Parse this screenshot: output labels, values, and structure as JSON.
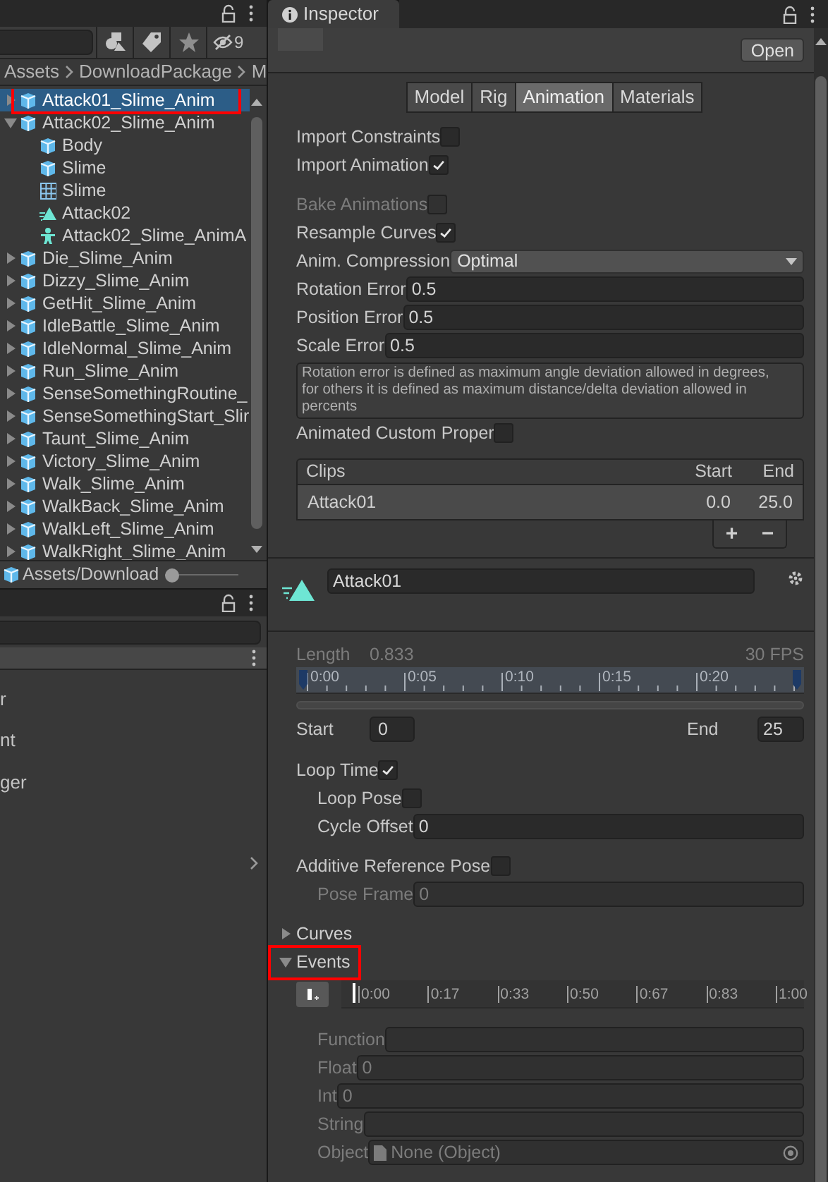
{
  "project": {
    "filter_count": "9",
    "breadcrumb": [
      "Assets",
      "DownloadPackage",
      "M"
    ],
    "tree": [
      {
        "label": "Attack01_Slime_Anim",
        "kind": "model",
        "expanded": false,
        "selected": true,
        "annotated": true
      },
      {
        "label": "Attack02_Slime_Anim",
        "kind": "model",
        "expanded": true,
        "selected": false,
        "annotated": false,
        "children": [
          {
            "label": "Body",
            "kind": "model"
          },
          {
            "label": "Slime",
            "kind": "model"
          },
          {
            "label": "Slime",
            "kind": "mesh"
          },
          {
            "label": "Attack02",
            "kind": "clip"
          },
          {
            "label": "Attack02_Slime_AnimA",
            "kind": "avatar"
          }
        ]
      },
      {
        "label": "Die_Slime_Anim",
        "kind": "model",
        "expanded": false,
        "selected": false,
        "annotated": false
      },
      {
        "label": "Dizzy_Slime_Anim",
        "kind": "model",
        "expanded": false,
        "selected": false,
        "annotated": false
      },
      {
        "label": "GetHit_Slime_Anim",
        "kind": "model",
        "expanded": false,
        "selected": false,
        "annotated": false
      },
      {
        "label": "IdleBattle_Slime_Anim",
        "kind": "model",
        "expanded": false,
        "selected": false,
        "annotated": false
      },
      {
        "label": "IdleNormal_Slime_Anim",
        "kind": "model",
        "expanded": false,
        "selected": false,
        "annotated": false
      },
      {
        "label": "Run_Slime_Anim",
        "kind": "model",
        "expanded": false,
        "selected": false,
        "annotated": false
      },
      {
        "label": "SenseSomethingRoutine_",
        "kind": "model",
        "expanded": false,
        "selected": false,
        "annotated": false
      },
      {
        "label": "SenseSomethingStart_Slir",
        "kind": "model",
        "expanded": false,
        "selected": false,
        "annotated": false
      },
      {
        "label": "Taunt_Slime_Anim",
        "kind": "model",
        "expanded": false,
        "selected": false,
        "annotated": false
      },
      {
        "label": "Victory_Slime_Anim",
        "kind": "model",
        "expanded": false,
        "selected": false,
        "annotated": false
      },
      {
        "label": "Walk_Slime_Anim",
        "kind": "model",
        "expanded": false,
        "selected": false,
        "annotated": false
      },
      {
        "label": "WalkBack_Slime_Anim",
        "kind": "model",
        "expanded": false,
        "selected": false,
        "annotated": false
      },
      {
        "label": "WalkLeft_Slime_Anim",
        "kind": "model",
        "expanded": false,
        "selected": false,
        "annotated": false
      },
      {
        "label": "WalkRight_Slime_Anim",
        "kind": "model",
        "expanded": false,
        "selected": false,
        "annotated": false
      }
    ],
    "footer_path": "Assets/Download",
    "zoom_slider": {
      "level": 0
    }
  },
  "lower_panel": {
    "items": [
      "r",
      "nt",
      "ger"
    ]
  },
  "inspector": {
    "title": "Inspector",
    "open_button": "Open",
    "tabs": [
      {
        "label": "Model",
        "selected": false
      },
      {
        "label": "Rig",
        "selected": false
      },
      {
        "label": "Animation",
        "selected": true
      },
      {
        "label": "Materials",
        "selected": false
      }
    ],
    "row_groups": [
      [
        {
          "kind": "checkbox",
          "label": "Import Constraints",
          "checked": false,
          "disabled": false
        },
        {
          "kind": "checkbox",
          "label": "Import Animation",
          "checked": true,
          "disabled": false
        }
      ],
      [
        {
          "kind": "checkbox",
          "label": "Bake Animations",
          "checked": false,
          "disabled": true
        },
        {
          "kind": "checkbox",
          "label": "Resample Curves",
          "checked": true,
          "disabled": false
        },
        {
          "kind": "dropdown",
          "label": "Anim. Compression",
          "value": "Optimal",
          "disabled": false
        },
        {
          "kind": "field",
          "label": "Rotation Error",
          "value": "0.5",
          "disabled": false
        },
        {
          "kind": "field",
          "label": "Position Error",
          "value": "0.5",
          "disabled": false
        },
        {
          "kind": "field",
          "label": "Scale Error",
          "value": "0.5",
          "disabled": false
        },
        {
          "kind": "help",
          "text": "Rotation error is defined as maximum angle deviation allowed in degrees, for others it is defined as maximum distance/delta deviation allowed in percents"
        },
        {
          "kind": "checkbox",
          "label": "Animated Custom Proper",
          "checked": false,
          "disabled": false
        }
      ]
    ],
    "clips": {
      "columns": [
        "Clips",
        "Start",
        "End"
      ],
      "rows": [
        {
          "name": "Attack01",
          "start": "0.0",
          "end": "25.0",
          "selected": true
        }
      ],
      "add_button": "+",
      "remove_button": "−"
    },
    "clip": {
      "name": "Attack01",
      "length_label": "Length",
      "length": "0.833",
      "fps": "30 FPS",
      "ticks": [
        "0:00",
        "0:05",
        "0:10",
        "0:15",
        "0:20"
      ],
      "start_label": "Start",
      "start": "0",
      "end_label": "End",
      "end": "25",
      "row_groups": [
        [
          {
            "kind": "checkbox",
            "label": "Loop Time",
            "checked": true,
            "disabled": false,
            "children": [
              {
                "kind": "checkbox",
                "label": "Loop Pose",
                "checked": false,
                "disabled": false
              },
              {
                "kind": "field",
                "label": "Cycle Offset",
                "value": "0",
                "disabled": false
              }
            ]
          }
        ],
        [
          {
            "kind": "checkbox",
            "label": "Additive Reference Pose",
            "checked": false,
            "disabled": false,
            "children": [
              {
                "kind": "field",
                "label": "Pose Frame",
                "value": "0",
                "disabled": true
              }
            ]
          }
        ]
      ]
    },
    "foldouts": [
      {
        "label": "Curves",
        "expanded": false,
        "annotated": false
      },
      {
        "label": "Events",
        "expanded": true,
        "annotated": true
      }
    ],
    "events": {
      "ticks": [
        "0:00",
        "0:17",
        "0:33",
        "0:50",
        "0:67",
        "0:83",
        "1:00"
      ],
      "fields": [
        {
          "kind": "field",
          "label": "Function",
          "disabled": true
        },
        {
          "kind": "field",
          "label": "Float",
          "value": "0",
          "disabled": true
        },
        {
          "kind": "field",
          "label": "Int",
          "value": "0",
          "disabled": true
        },
        {
          "kind": "field",
          "label": "String",
          "disabled": true
        },
        {
          "kind": "object",
          "label": "Object",
          "value": "None (Object)",
          "disabled": true
        }
      ]
    }
  }
}
